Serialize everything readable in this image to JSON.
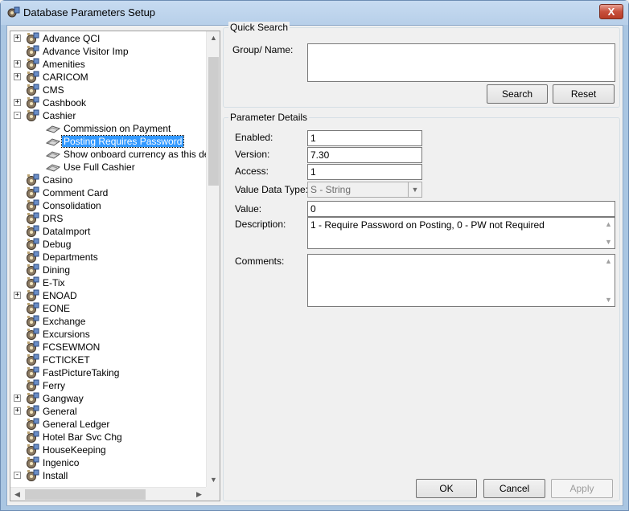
{
  "window": {
    "title": "Database Parameters Setup",
    "close_label": "X"
  },
  "tree": {
    "items": [
      {
        "label": "Advance QCI",
        "level": 0,
        "expander": "+"
      },
      {
        "label": "Advance Visitor Imp",
        "level": 0,
        "expander": ""
      },
      {
        "label": "Amenities",
        "level": 0,
        "expander": "+"
      },
      {
        "label": "CARICOM",
        "level": 0,
        "expander": "+"
      },
      {
        "label": "CMS",
        "level": 0,
        "expander": ""
      },
      {
        "label": "Cashbook",
        "level": 0,
        "expander": "+"
      },
      {
        "label": "Cashier",
        "level": 0,
        "expander": "-"
      },
      {
        "label": "Commission on Payment",
        "level": 1,
        "expander": ""
      },
      {
        "label": "Posting Requires Password",
        "level": 1,
        "expander": "",
        "selected": true
      },
      {
        "label": "Show onboard currency as this dept",
        "level": 1,
        "expander": ""
      },
      {
        "label": "Use Full Cashier",
        "level": 1,
        "expander": ""
      },
      {
        "label": "Casino",
        "level": 0,
        "expander": ""
      },
      {
        "label": "Comment Card",
        "level": 0,
        "expander": ""
      },
      {
        "label": "Consolidation",
        "level": 0,
        "expander": ""
      },
      {
        "label": "DRS",
        "level": 0,
        "expander": ""
      },
      {
        "label": "DataImport",
        "level": 0,
        "expander": ""
      },
      {
        "label": "Debug",
        "level": 0,
        "expander": ""
      },
      {
        "label": "Departments",
        "level": 0,
        "expander": ""
      },
      {
        "label": "Dining",
        "level": 0,
        "expander": ""
      },
      {
        "label": "E-Tix",
        "level": 0,
        "expander": ""
      },
      {
        "label": "ENOAD",
        "level": 0,
        "expander": "+"
      },
      {
        "label": "EONE",
        "level": 0,
        "expander": ""
      },
      {
        "label": "Exchange",
        "level": 0,
        "expander": ""
      },
      {
        "label": "Excursions",
        "level": 0,
        "expander": ""
      },
      {
        "label": "FCSEWMON",
        "level": 0,
        "expander": ""
      },
      {
        "label": "FCTICKET",
        "level": 0,
        "expander": ""
      },
      {
        "label": "FastPictureTaking",
        "level": 0,
        "expander": ""
      },
      {
        "label": "Ferry",
        "level": 0,
        "expander": ""
      },
      {
        "label": "Gangway",
        "level": 0,
        "expander": "+"
      },
      {
        "label": "General",
        "level": 0,
        "expander": "+"
      },
      {
        "label": "General Ledger",
        "level": 0,
        "expander": ""
      },
      {
        "label": "Hotel Bar Svc Chg",
        "level": 0,
        "expander": ""
      },
      {
        "label": "HouseKeeping",
        "level": 0,
        "expander": ""
      },
      {
        "label": "Ingenico",
        "level": 0,
        "expander": ""
      },
      {
        "label": "Install",
        "level": 0,
        "expander": "-"
      }
    ]
  },
  "quick_search": {
    "title": "Quick Search",
    "group_name_label": "Group/ Name:",
    "group_name_value": "",
    "search_button": "Search",
    "reset_button": "Reset"
  },
  "parameter_details": {
    "title": "Parameter Details",
    "enabled_label": "Enabled:",
    "enabled_value": "1",
    "version_label": "Version:",
    "version_value": "7.30",
    "access_label": "Access:",
    "access_value": "1",
    "value_data_type_label": "Value Data Type:",
    "value_data_type_value": "S - String",
    "value_label": "Value:",
    "value_value": "0",
    "description_label": "Description:",
    "description_value": "1 - Require Password on Posting, 0 - PW not Required",
    "comments_label": "Comments:",
    "comments_value": ""
  },
  "footer": {
    "ok": "OK",
    "cancel": "Cancel",
    "apply": "Apply"
  },
  "colors": {
    "selection": "#3399ff",
    "title_bar": "#b7cfe9"
  }
}
